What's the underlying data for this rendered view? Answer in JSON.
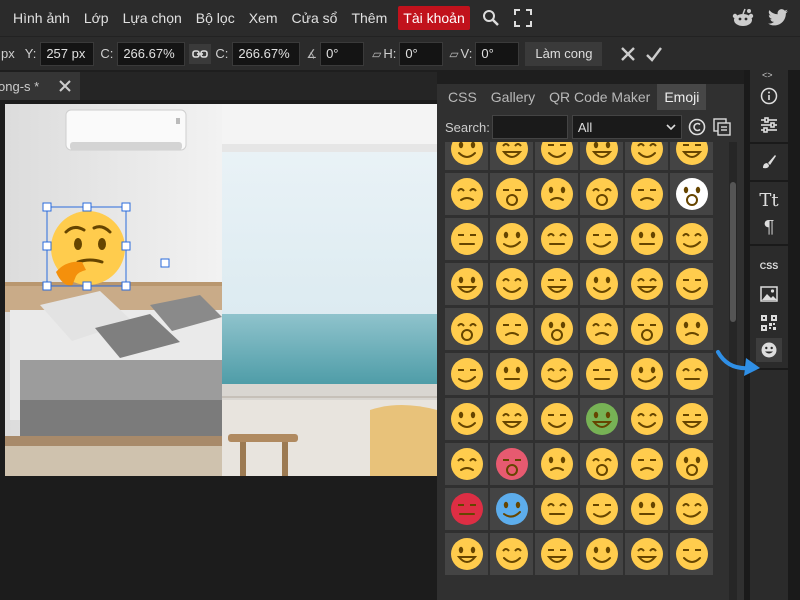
{
  "menubar": {
    "items": [
      "Hình ảnh",
      "Lớp",
      "Lựa chọn",
      "Bộ lọc",
      "Xem",
      "Cửa sổ",
      "Thêm"
    ],
    "account_label": "Tài khoản",
    "icons": [
      "search-icon",
      "fullscreen-icon",
      "reddit-icon",
      "twitter-icon"
    ]
  },
  "toolbar": {
    "x_unit": "px",
    "y_label": "Y:",
    "y_value": "257 px",
    "c1_label": "C:",
    "c1_value": "266.67%",
    "c2_label": "C:",
    "c2_value": "266.67%",
    "angle_value": "0°",
    "h_label": "H:",
    "h_value": "0°",
    "v_label": "V:",
    "v_value": "0°",
    "round_button": "Làm cong",
    "cancel_icon": "close-icon",
    "confirm_icon": "check-icon"
  },
  "document": {
    "tab_label": "ong-s *"
  },
  "panel": {
    "tabs": [
      "CSS",
      "Gallery",
      "QR Code Maker",
      "Emoji"
    ],
    "active_tab": "Emoji",
    "search_label": "Search:",
    "search_value": "",
    "category_value": "All",
    "emoji_rows": 10,
    "emoji_cols": 6
  },
  "right_sidebar": {
    "toggle_label": "<>",
    "css_label": "CSS",
    "icons": [
      "info-icon",
      "adjustments-icon",
      "brush-icon",
      "text-icon",
      "paragraph-icon",
      "css-icon",
      "image-icon",
      "qr-icon",
      "emoji-icon"
    ]
  },
  "colors": {
    "accent_red": "#c1121c",
    "emoji_yellow": "#ffcc4d",
    "arrow_blue": "#2f8fe6",
    "selection_blue": "#2a6bdc"
  }
}
